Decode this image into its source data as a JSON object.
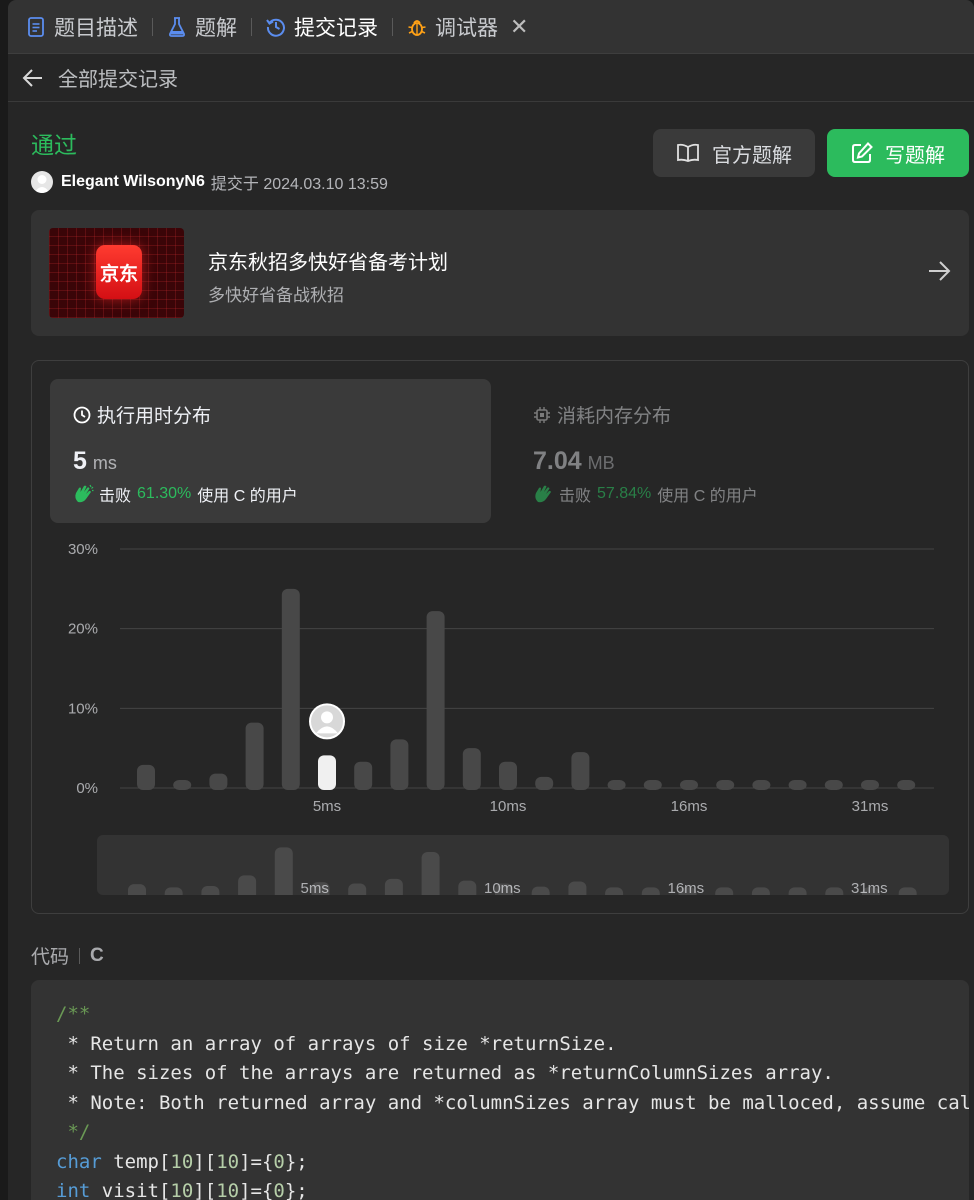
{
  "tabs": [
    {
      "label": "题目描述",
      "icon": "document-icon"
    },
    {
      "label": "题解",
      "icon": "flask-icon"
    },
    {
      "label": "提交记录",
      "icon": "history-icon",
      "active": true
    },
    {
      "label": "调试器",
      "icon": "bug-icon",
      "closable": true
    }
  ],
  "subheader": {
    "title": "全部提交记录"
  },
  "submission": {
    "status": "通过",
    "user": "Elegant WilsonyN6",
    "submitted_at": "提交于 2024.03.10 13:59",
    "official_solution_label": "官方题解",
    "write_solution_label": "写题解"
  },
  "promo": {
    "logo_text": "京东",
    "title": "京东秋招多快好省备考计划",
    "subtitle": "多快好省备战秋招"
  },
  "runtime": {
    "title": "执行用时分布",
    "value": "5",
    "unit": "ms",
    "beat_label": "击败",
    "beat_pct": "61.30%",
    "beat_suffix": "使用 C 的用户"
  },
  "memory": {
    "title": "消耗内存分布",
    "value": "7.04",
    "unit": "MB",
    "beat_label": "击败",
    "beat_pct": "57.84%",
    "beat_suffix": "使用 C 的用户"
  },
  "chart_data": {
    "type": "bar",
    "ylim": [
      0,
      30
    ],
    "yticks": [
      "30%",
      "20%",
      "10%",
      "0%"
    ],
    "xtick_labels": [
      {
        "index": 5,
        "label": "5ms"
      },
      {
        "index": 10,
        "label": "10ms"
      },
      {
        "index": 15,
        "label": "16ms"
      },
      {
        "index": 20,
        "label": "31ms"
      }
    ],
    "values": [
      2.9,
      1.0,
      1.8,
      8.2,
      25.0,
      4.1,
      3.3,
      6.1,
      22.2,
      5.0,
      3.3,
      1.4,
      4.5,
      1.0,
      1.0,
      1.0,
      1.0,
      1.0,
      1.0,
      1.0,
      1.0,
      1.0
    ],
    "highlight_index": 5,
    "colors": {
      "bar": "#484848",
      "highlight": "#f0f0f0",
      "grid": "#444444"
    }
  },
  "code": {
    "label": "代码",
    "language": "C",
    "lines": [
      [
        {
          "t": "/**",
          "c": "comment"
        }
      ],
      [
        {
          "t": " * Return an array of arrays of size *returnSize.",
          "c": "plain"
        }
      ],
      [
        {
          "t": " * The sizes of the arrays are returned as *returnColumnSizes array.",
          "c": "plain"
        }
      ],
      [
        {
          "t": " * Note: Both returned array and *columnSizes array must be malloced, assume caller calls free().",
          "c": "plain"
        }
      ],
      [
        {
          "t": " */",
          "c": "comment"
        }
      ],
      [
        {
          "t": "char",
          "c": "type"
        },
        {
          "t": " temp[",
          "c": "plain"
        },
        {
          "t": "10",
          "c": "num"
        },
        {
          "t": "][",
          "c": "plain"
        },
        {
          "t": "10",
          "c": "num"
        },
        {
          "t": "]={",
          "c": "plain"
        },
        {
          "t": "0",
          "c": "num"
        },
        {
          "t": "};",
          "c": "plain"
        }
      ],
      [
        {
          "t": "int",
          "c": "type"
        },
        {
          "t": " visit[",
          "c": "plain"
        },
        {
          "t": "10",
          "c": "num"
        },
        {
          "t": "][",
          "c": "plain"
        },
        {
          "t": "10",
          "c": "num"
        },
        {
          "t": "]={",
          "c": "plain"
        },
        {
          "t": "0",
          "c": "num"
        },
        {
          "t": "};",
          "c": "plain"
        }
      ]
    ]
  }
}
